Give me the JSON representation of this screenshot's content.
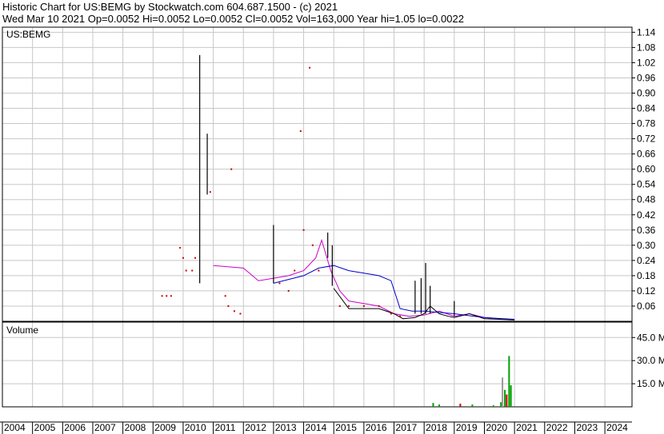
{
  "header": {
    "line1": "Historic Chart for US:BEMG by Stockwatch.com 604.687.1500 - (c) 2021",
    "line2": "Wed Mar 10 2021   Op=0.0052   Hi=0.0052   Lo=0.0052   Cl=0.0052   Vol=163,000   Year hi=1.05   lo=0.0022"
  },
  "colors": {
    "price": "#000000",
    "price_dots": "#cc0000",
    "ma_short": "#cc00cc",
    "ma_long": "#0000cc",
    "vol_up": "#00a000",
    "vol_down": "#cc0000",
    "vol_flat": "#999999",
    "grid": "#c8c8c8"
  },
  "chart_data": [
    {
      "type": "line",
      "title": "US:BEMG",
      "ylim": [
        0,
        1.16
      ],
      "yticks": [
        "1.14",
        "1.08",
        "1.02",
        "0.96",
        "0.90",
        "0.84",
        "0.78",
        "0.72",
        "0.66",
        "0.60",
        "0.54",
        "0.48",
        "0.42",
        "0.36",
        "0.30",
        "0.24",
        "0.18",
        "0.12",
        "0.06"
      ],
      "xlim": [
        2004,
        2024.9
      ],
      "series": [
        {
          "key": "ma_short",
          "x": [
            2011.0,
            2012.0,
            2012.5,
            2013.0,
            2013.5,
            2014.0,
            2014.4,
            2014.6,
            2014.9,
            2015.2,
            2015.5,
            2016.0,
            2016.5,
            2017.0,
            2017.5,
            2018.0,
            2018.5,
            2019.0,
            2019.5,
            2020.0,
            2020.5,
            2021.0
          ],
          "y": [
            0.22,
            0.21,
            0.16,
            0.17,
            0.18,
            0.2,
            0.25,
            0.32,
            0.2,
            0.12,
            0.08,
            0.07,
            0.06,
            0.03,
            0.02,
            0.025,
            0.04,
            0.02,
            0.03,
            0.015,
            0.01,
            0.006
          ]
        },
        {
          "key": "ma_long",
          "x": [
            2013.0,
            2014.0,
            2014.5,
            2015.0,
            2015.5,
            2016.0,
            2016.5,
            2016.9,
            2017.2,
            2017.6,
            2018.0,
            2018.5,
            2019.0,
            2019.5,
            2020.0,
            2020.5,
            2021.0
          ],
          "y": [
            0.15,
            0.18,
            0.21,
            0.22,
            0.2,
            0.19,
            0.18,
            0.16,
            0.05,
            0.04,
            0.04,
            0.035,
            0.03,
            0.022,
            0.015,
            0.011,
            0.008
          ]
        },
        {
          "key": "price",
          "x": [
            2015.0,
            2015.5,
            2016.0,
            2016.5,
            2017.0,
            2017.3,
            2017.7,
            2018.0,
            2018.2,
            2018.5,
            2018.8,
            2019.0,
            2019.5,
            2020.0,
            2020.5,
            2021.0
          ],
          "y": [
            0.13,
            0.05,
            0.05,
            0.05,
            0.03,
            0.01,
            0.015,
            0.03,
            0.06,
            0.03,
            0.02,
            0.015,
            0.03,
            0.01,
            0.008,
            0.005
          ]
        }
      ],
      "bars": [
        {
          "x": 2010.55,
          "hi": 1.05,
          "lo": 0.15
        },
        {
          "x": 2010.8,
          "hi": 0.74,
          "lo": 0.5
        },
        {
          "x": 2013.0,
          "hi": 0.38,
          "lo": 0.15
        },
        {
          "x": 2014.8,
          "hi": 0.35,
          "lo": 0.25
        },
        {
          "x": 2014.95,
          "hi": 0.3,
          "lo": 0.14
        },
        {
          "x": 2017.7,
          "hi": 0.16,
          "lo": 0.03
        },
        {
          "x": 2017.9,
          "hi": 0.17,
          "lo": 0.03
        },
        {
          "x": 2018.05,
          "hi": 0.23,
          "lo": 0.03
        },
        {
          "x": 2018.2,
          "hi": 0.14,
          "lo": 0.03
        },
        {
          "x": 2019.0,
          "hi": 0.08,
          "lo": 0.02
        }
      ],
      "dots": [
        [
          2009.3,
          0.1
        ],
        [
          2009.45,
          0.1
        ],
        [
          2009.6,
          0.1
        ],
        [
          2009.9,
          0.29
        ],
        [
          2010.0,
          0.25
        ],
        [
          2010.1,
          0.2
        ],
        [
          2010.3,
          0.2
        ],
        [
          2010.4,
          0.25
        ],
        [
          2010.9,
          0.51
        ],
        [
          2011.6,
          0.6
        ],
        [
          2011.4,
          0.1
        ],
        [
          2011.5,
          0.06
        ],
        [
          2011.7,
          0.04
        ],
        [
          2011.9,
          0.03
        ],
        [
          2013.2,
          0.15
        ],
        [
          2013.5,
          0.12
        ],
        [
          2013.7,
          0.2
        ],
        [
          2013.9,
          0.75
        ],
        [
          2014.2,
          1.0
        ],
        [
          2014.0,
          0.36
        ],
        [
          2014.3,
          0.3
        ],
        [
          2014.5,
          0.2
        ],
        [
          2015.2,
          0.06
        ],
        [
          2015.5,
          0.06
        ],
        [
          2016.0,
          0.06
        ],
        [
          2016.5,
          0.06
        ],
        [
          2016.9,
          0.03
        ],
        [
          2017.2,
          0.02
        ]
      ]
    },
    {
      "type": "bar",
      "title": "Volume",
      "ylim": [
        0,
        55
      ],
      "yticks": [
        "45.0 M",
        "30.0 M",
        "15.0 M"
      ],
      "bars": [
        {
          "x": 2018.3,
          "v": 2.5,
          "c": "vol_up"
        },
        {
          "x": 2018.5,
          "v": 1.5,
          "c": "vol_up"
        },
        {
          "x": 2019.2,
          "v": 2.0,
          "c": "vol_down"
        },
        {
          "x": 2019.6,
          "v": 1.5,
          "c": "vol_up"
        },
        {
          "x": 2020.3,
          "v": 1.0,
          "c": "vol_up"
        },
        {
          "x": 2020.55,
          "v": 3.0,
          "c": "vol_up"
        },
        {
          "x": 2020.6,
          "v": 19.0,
          "c": "vol_flat"
        },
        {
          "x": 2020.68,
          "v": 11.0,
          "c": "vol_up"
        },
        {
          "x": 2020.74,
          "v": 8.0,
          "c": "vol_down"
        },
        {
          "x": 2020.82,
          "v": 33.0,
          "c": "vol_up"
        },
        {
          "x": 2020.88,
          "v": 14.0,
          "c": "vol_up"
        }
      ]
    }
  ],
  "x_axis": {
    "labels": [
      "2004",
      "2005",
      "2006",
      "2007",
      "2008",
      "2009",
      "2010",
      "2011",
      "2012",
      "2013",
      "2014",
      "2015",
      "2016",
      "2017",
      "2018",
      "2019",
      "2020",
      "2021",
      "2022",
      "2023",
      "2024"
    ]
  }
}
